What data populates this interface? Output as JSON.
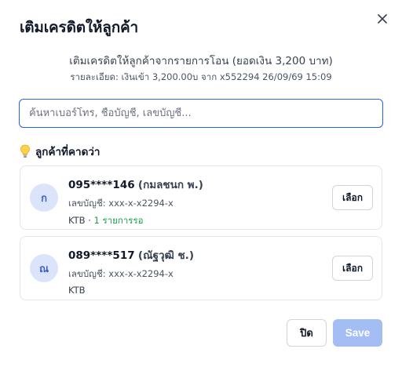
{
  "dialog": {
    "title": "เติมเครดิตให้ลูกค้า",
    "close_icon": "close-icon"
  },
  "transaction": {
    "summary": "เติมเครดิตให้ลูกค้าจากรายการโอน (ยอดเงิน 3,200 บาท)",
    "details": "รายละเอียด: เงินเข้า 3,200.00บ จาก x552294 26/09/69 15:09"
  },
  "search": {
    "placeholder": "ค้นหาเบอร์โทร, ชื่อบัญชี, เลขบัญชี...",
    "value": ""
  },
  "suggestions": {
    "icon": "lightbulb-icon",
    "heading": "ลูกค้าที่คาดว่า",
    "items": [
      {
        "avatar": "ก",
        "phone": "095****146",
        "holder": "(กมลชนก พ.)",
        "account": "เลขบัญชี: xxx-x-x2294-x",
        "bank": "KTB",
        "separator": " · ",
        "pending": "1 รายการรอ",
        "select_label": "เลือก"
      },
      {
        "avatar": "ณ",
        "phone": "089****517",
        "holder": "(ณัฐวุฒิ ช.)",
        "account": "เลขบัญชี: xxx-x-x2294-x",
        "bank": "KTB",
        "select_label": "เลือก"
      }
    ]
  },
  "footer": {
    "close_label": "ปิด",
    "save_label": "Save"
  },
  "colors": {
    "accent": "#2563eb",
    "save_disabled": "#a5bdf5",
    "pending_green": "#16a34a",
    "avatar_bg": "#dbe4fb"
  }
}
